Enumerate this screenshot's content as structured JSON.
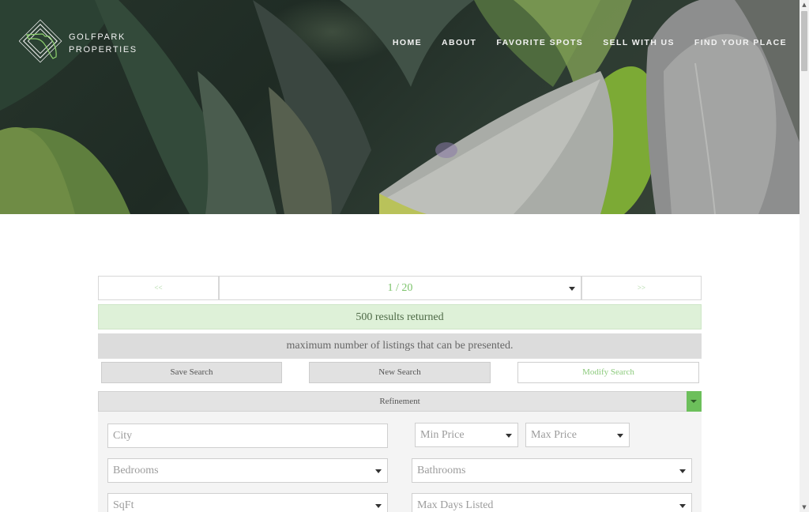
{
  "brand": {
    "line1": "GOLFPARK",
    "line2": "PROPERTIES"
  },
  "nav": {
    "items": [
      {
        "label": "HOME"
      },
      {
        "label": "ABOUT"
      },
      {
        "label": "FAVORITE SPOTS"
      },
      {
        "label": "SELL WITH US"
      },
      {
        "label": "FIND YOUR PLACE"
      }
    ]
  },
  "pager": {
    "prev": "<<",
    "current": "1 / 20",
    "next": ">>"
  },
  "results": {
    "text": "500 results returned"
  },
  "notice": {
    "text": "maximum number of listings that can be presented."
  },
  "actions": {
    "save": "Save Search",
    "new": "New Search",
    "modify": "Modify Search"
  },
  "refinement": {
    "label": "Refinement",
    "city_placeholder": "City",
    "min_price": "Min Price",
    "max_price": "Max Price",
    "bedrooms": "Bedrooms",
    "bathrooms": "Bathrooms",
    "sqft": "SqFt",
    "max_days": "Max Days Listed"
  },
  "colors": {
    "accent_green": "#6cbf5b",
    "results_bg": "#def1d8",
    "notice_bg": "#dcdcdc"
  }
}
